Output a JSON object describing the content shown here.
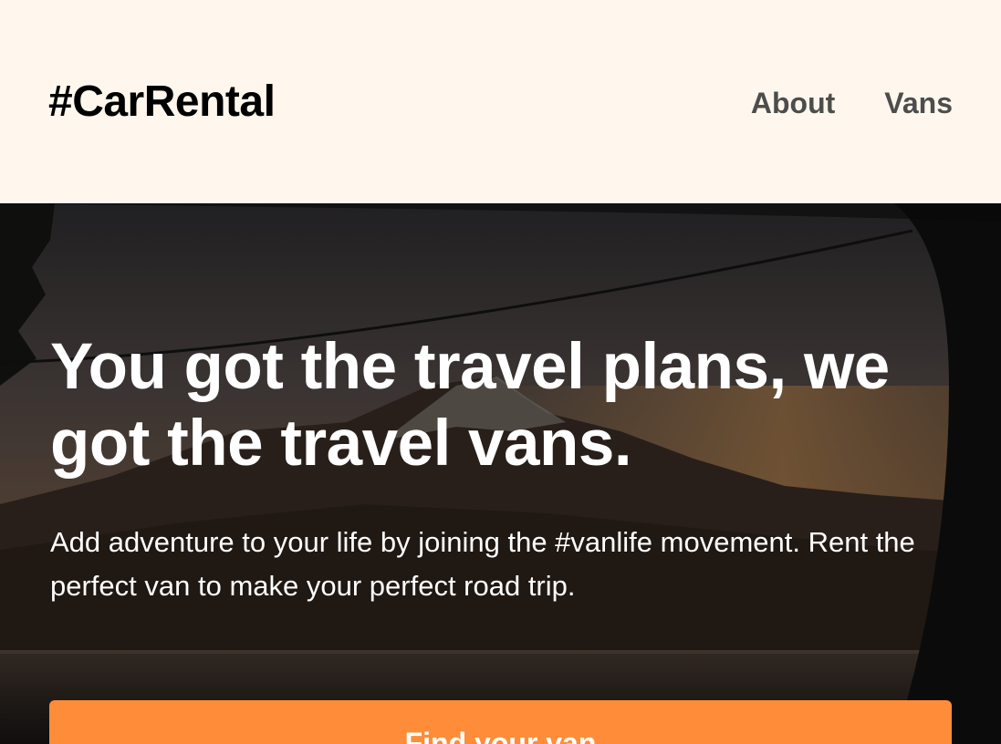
{
  "header": {
    "logo": "#CarRental",
    "nav": [
      {
        "label": "About"
      },
      {
        "label": "Vans"
      }
    ]
  },
  "hero": {
    "title": "You got the travel plans, we got the travel vans.",
    "subtitle": "Add adventure to your life by joining the #vanlife movement. Rent the perfect van to make your perfect road trip.",
    "cta_label": "Find your van",
    "image": "mountain-lake-through-van-window"
  },
  "colors": {
    "header_bg": "#FFF7ED",
    "cta_bg": "#FF8C38",
    "nav_text": "#4D4D4D"
  }
}
